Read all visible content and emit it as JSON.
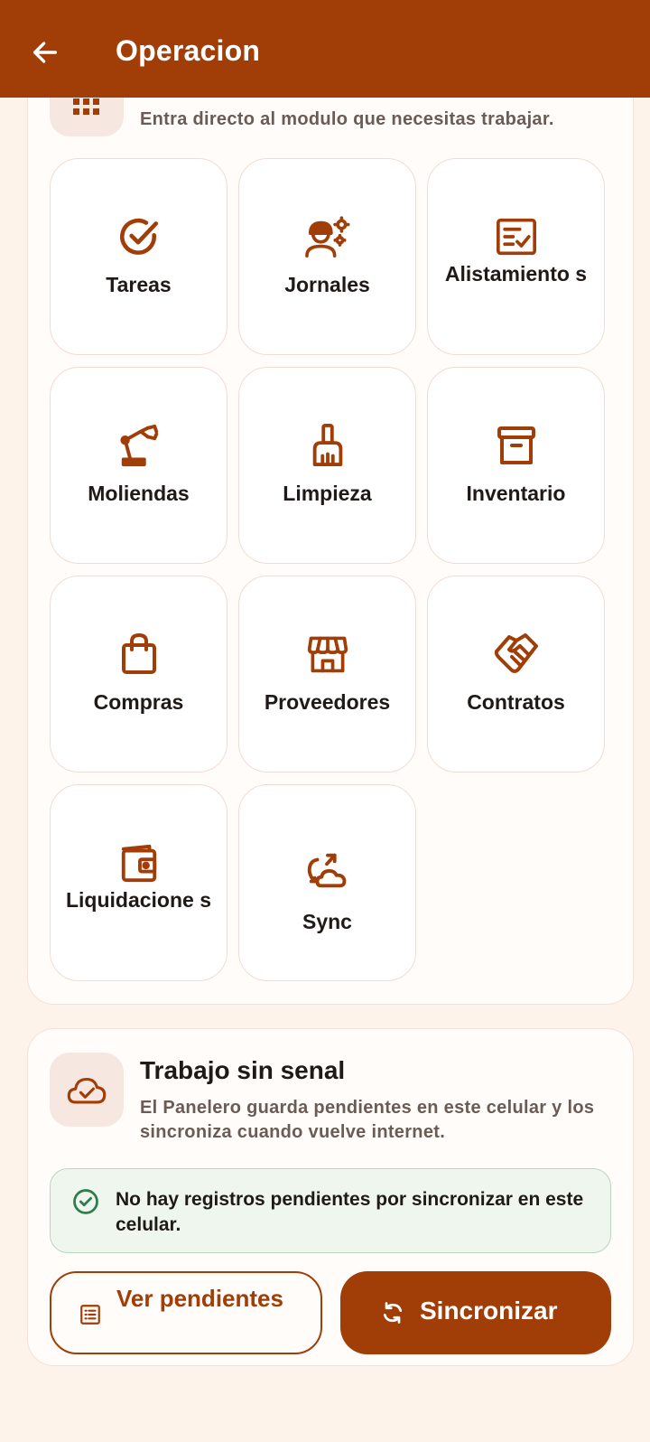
{
  "appbar": {
    "title": "Operacion",
    "back_icon": "arrow-left-icon",
    "background": "#a13d06"
  },
  "modules": {
    "header_icon": "grid-icon",
    "subtitle": "Entra directo al modulo que necesitas trabajar.",
    "items": [
      {
        "label": "Tareas",
        "icon": "check-circle-icon"
      },
      {
        "label": "Jornales",
        "icon": "worker-gear-icon"
      },
      {
        "label": "Alistamiento s",
        "icon": "checklist-icon"
      },
      {
        "label": "Moliendas",
        "icon": "robot-arm-icon"
      },
      {
        "label": "Limpieza",
        "icon": "broom-icon"
      },
      {
        "label": "Inventario",
        "icon": "archive-box-icon"
      },
      {
        "label": "Compras",
        "icon": "shopping-bag-icon"
      },
      {
        "label": "Proveedores",
        "icon": "storefront-icon"
      },
      {
        "label": "Contratos",
        "icon": "handshake-icon"
      },
      {
        "label": "Liquidacione s",
        "icon": "wallet-icon"
      },
      {
        "label": "Sync",
        "icon": "cloud-sync-icon"
      }
    ]
  },
  "offline": {
    "icon": "cloud-check-icon",
    "title": "Trabajo sin senal",
    "description": "El Panelero guarda pendientes en este celular y los sincroniza cuando vuelve internet.",
    "status_icon": "check-circle-icon",
    "status_text": "No hay registros pendientes por sincronizar en este celular.",
    "status_color": "#2e7d4a",
    "pending_button": {
      "label": "Ver pendientes",
      "icon": "list-icon"
    },
    "sync_button": {
      "label": "Sincronizar",
      "icon": "sync-icon"
    }
  },
  "colors": {
    "accent": "#a13d06",
    "page_background": "#fdf3eb",
    "tile_border": "#f1dcd3"
  }
}
